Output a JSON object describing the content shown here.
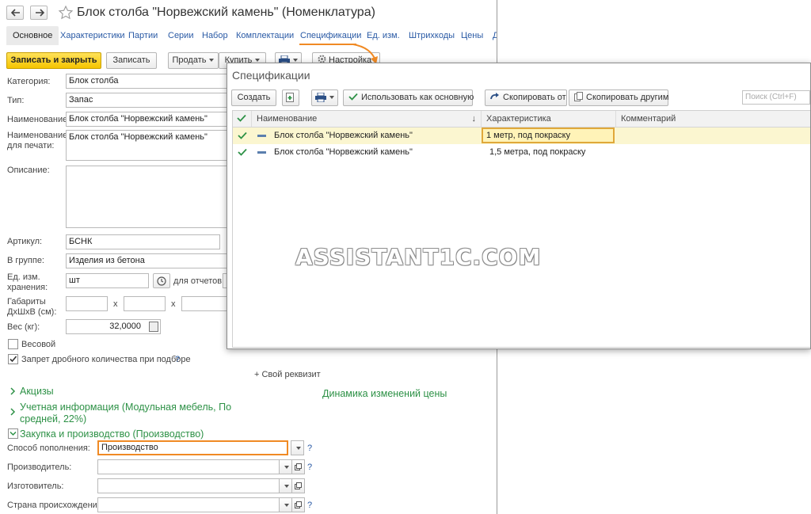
{
  "window": {
    "title": "Блок столба \"Норвежский камень\" (Номенклатура)"
  },
  "tabs": [
    {
      "label": "Основное",
      "active": true
    },
    {
      "label": "Характеристики"
    },
    {
      "label": "Партии"
    },
    {
      "label": "Серии"
    },
    {
      "label": "Набор"
    },
    {
      "label": "Комплектации"
    },
    {
      "label": "Спецификации"
    },
    {
      "label": "Ед. изм."
    },
    {
      "label": "Штрихкоды"
    },
    {
      "label": "Цены"
    },
    {
      "label": "Д"
    }
  ],
  "toolbar": {
    "save_close": "Записать и закрыть",
    "save": "Записать",
    "sell": "Продать",
    "buy": "Купить",
    "settings": "Настройка"
  },
  "form": {
    "category": {
      "label": "Категория:",
      "value": "Блок столба"
    },
    "type": {
      "label": "Тип:",
      "value": "Запас"
    },
    "name": {
      "label": "Наименование:",
      "value": "Блок столба \"Норвежский камень\""
    },
    "print_name": {
      "label": "Наименование\nдля печати:",
      "value": "Блок столба \"Норвежский камень\""
    },
    "description": {
      "label": "Описание:",
      "value": ""
    },
    "article": {
      "label": "Артикул:",
      "value": "БСНК"
    },
    "group": {
      "label": "В группе:",
      "value": "Изделия из бетона"
    },
    "unit": {
      "label": "Ед. изм.\nхранения:",
      "value": "шт",
      "reports_label": "для отчетов:"
    },
    "dims": {
      "label": "Габариты\nДхШхВ (см):",
      "sep": "x"
    },
    "weight": {
      "label": "Вес (кг):",
      "value": "32,0000"
    },
    "weighted": {
      "label": "Весовой",
      "checked": false
    },
    "no_fraction": {
      "label": "Запрет дробного количества при подборе",
      "checked": true,
      "help": "?"
    },
    "custom_attr": "+ Свой реквизит"
  },
  "sections": {
    "excise": "Акцизы",
    "accounting": "Учетная информация (Модульная мебель, По\nсредней, 22%)",
    "price_dynamics": "Динамика изменений цены",
    "purchase": "Закупка и производство (Производство)"
  },
  "purchase_form": {
    "replenishment": {
      "label": "Способ пополнения:",
      "value": "Производство"
    },
    "producer": {
      "label": "Производитель:",
      "value": ""
    },
    "manufacturer": {
      "label": "Изготовитель:",
      "value": ""
    },
    "country": {
      "label": "Страна происхождения:",
      "value": ""
    },
    "help": "?"
  },
  "popup": {
    "title": "Спецификации",
    "create": "Создать",
    "use_main": "Использовать как основную",
    "copy_from": "Скопировать от",
    "copy_to": "Скопировать другим",
    "search_placeholder": "Поиск (Ctrl+F)",
    "columns": {
      "name": "Наименование",
      "sort": "↓",
      "characteristic": "Характеристика",
      "comment": "Комментарий"
    },
    "rows": [
      {
        "name": "Блок столба \"Норвежский камень\"",
        "characteristic": "1 метр, под покраску",
        "comment": "",
        "selected": true
      },
      {
        "name": "Блок столба \"Норвежский камень\"",
        "characteristic": "1,5 метра, под покраску",
        "comment": "",
        "selected": false
      }
    ]
  },
  "watermark": "ASSISTANT1C.COM",
  "colors": {
    "accent_yellow": "#f5c400",
    "link_blue": "#2a5aa5",
    "section_green": "#2d9146",
    "highlight_orange": "#f08a24",
    "selected_row": "#fbf6d0"
  }
}
